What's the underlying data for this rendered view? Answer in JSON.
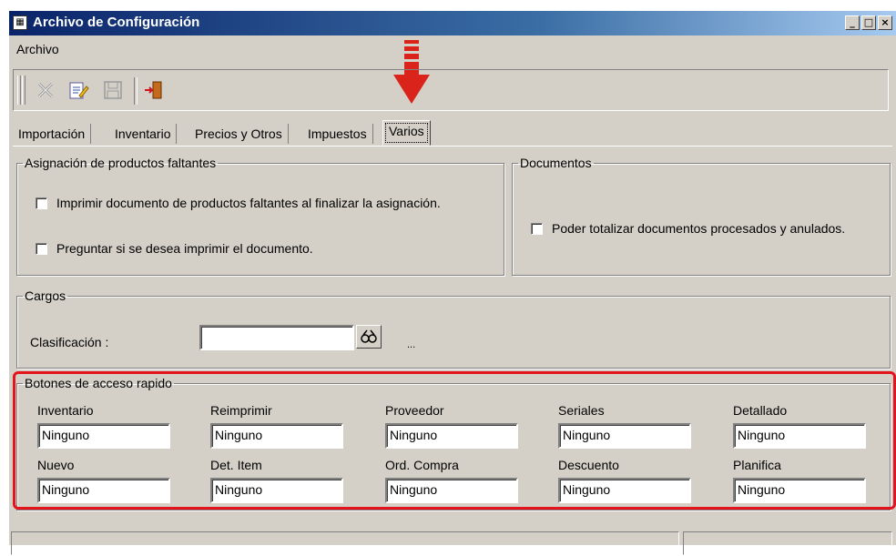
{
  "window": {
    "title": "Archivo de Configuración",
    "controls": [
      "minimize-icon",
      "maximize-icon",
      "close-icon"
    ],
    "control_glyphs": [
      "_",
      "□",
      "×"
    ]
  },
  "menu": {
    "items": [
      "Archivo"
    ]
  },
  "toolbar": {
    "icons": [
      "delete-icon",
      "edit-icon",
      "save-icon",
      "exit-icon"
    ]
  },
  "tabs": [
    "Importación",
    "Inventario",
    "Precios y Otros",
    "Impuestos",
    "Varios"
  ],
  "active_tab": "Varios",
  "asignacion": {
    "legend": "Asignación de productos faltantes",
    "options": [
      {
        "label": "Imprimir documento de productos faltantes al finalizar la asignación.",
        "checked": false
      },
      {
        "label": "Preguntar si se desea imprimir el documento.",
        "checked": false
      }
    ]
  },
  "documentos": {
    "legend": "Documentos",
    "options": [
      {
        "label": "Poder totalizar documentos procesados y anulados.",
        "checked": false
      }
    ]
  },
  "cargos": {
    "legend": "Cargos",
    "clasificacion_label": "Clasificación :",
    "clasificacion_value": "",
    "ellipsis": "..."
  },
  "botones": {
    "legend": "Botones de acceso rapido",
    "row1": [
      {
        "label": "Inventario",
        "value": "Ninguno"
      },
      {
        "label": "Reimprimir",
        "value": "Ninguno"
      },
      {
        "label": "Proveedor",
        "value": "Ninguno"
      },
      {
        "label": "Seriales",
        "value": "Ninguno"
      },
      {
        "label": "Detallado",
        "value": "Ninguno"
      }
    ],
    "row2": [
      {
        "label": "Nuevo",
        "value": "Ninguno"
      },
      {
        "label": "Det. Item",
        "value": "Ninguno"
      },
      {
        "label": "Ord. Compra",
        "value": "Ninguno"
      },
      {
        "label": "Descuento",
        "value": "Ninguno"
      },
      {
        "label": "Planifica",
        "value": "Ninguno"
      }
    ]
  },
  "annotation": {
    "arrow_color": "#d9231b",
    "highlight_color": "#e3141b"
  }
}
